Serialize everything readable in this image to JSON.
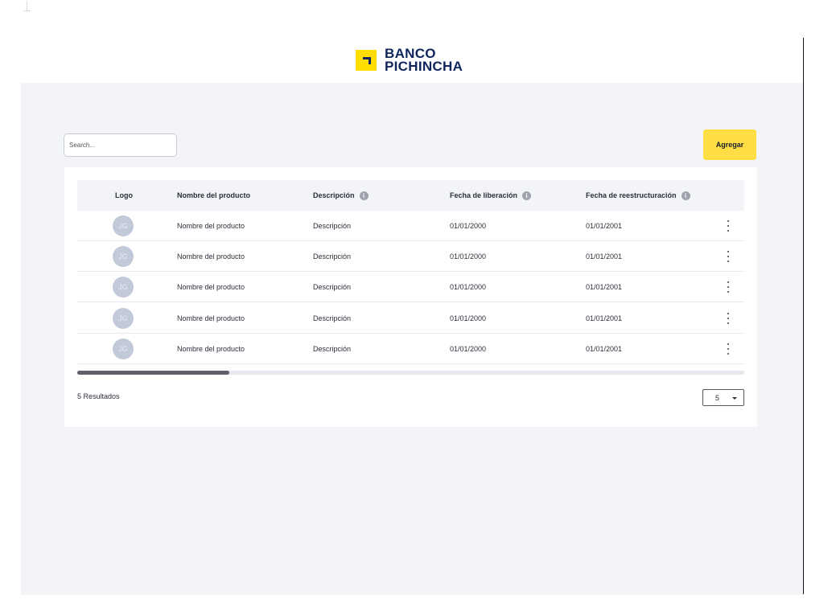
{
  "brand": {
    "line1": "BANCO",
    "line2": "PICHINCHA",
    "icon": "banco-pichincha-logo-icon",
    "color": "#0f265c",
    "accent": "#ffdd00"
  },
  "toolbar": {
    "search_placeholder": "Search...",
    "add_label": "Agregar"
  },
  "table": {
    "columns": [
      "Logo",
      "Nombre del producto",
      "Descripción",
      "Fecha de liberación",
      "Fecha de reestructuración"
    ],
    "rows": [
      {
        "initials": "JG",
        "name": "Nombre del producto",
        "description": "Descripción",
        "release_date": "01/01/2000",
        "restructure_date": "01/01/2001"
      },
      {
        "initials": "JG",
        "name": "Nombre del producto",
        "description": "Descripción",
        "release_date": "01/01/2000",
        "restructure_date": "01/01/2001"
      },
      {
        "initials": "JG",
        "name": "Nombre del producto",
        "description": "Descripción",
        "release_date": "01/01/2000",
        "restructure_date": "01/01/2001"
      },
      {
        "initials": "JG",
        "name": "Nombre del producto",
        "description": "Descripción",
        "release_date": "01/01/2000",
        "restructure_date": "01/01/2001"
      },
      {
        "initials": "JG",
        "name": "Nombre del producto",
        "description": "Descripción",
        "release_date": "01/01/2000",
        "restructure_date": "01/01/2001"
      }
    ]
  },
  "footer": {
    "results_label": "5 Resultados",
    "page_size": "5"
  }
}
